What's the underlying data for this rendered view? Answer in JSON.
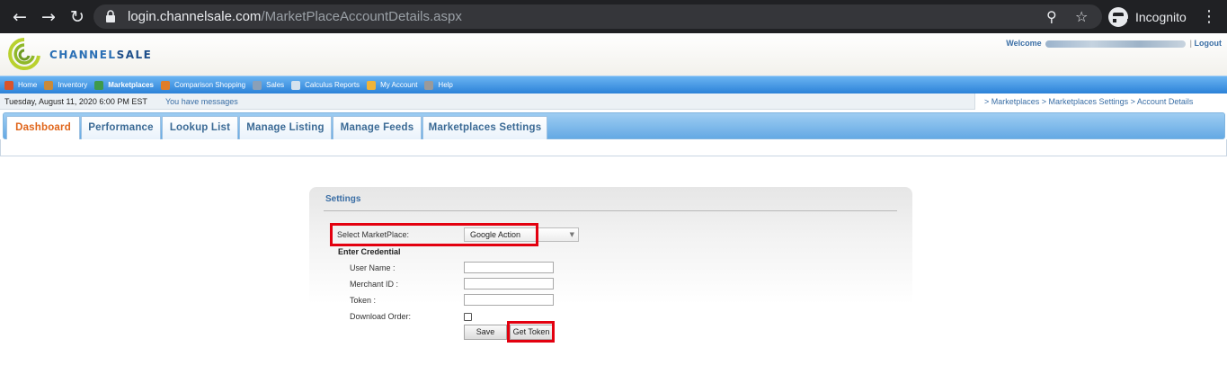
{
  "browser": {
    "url_host": "login.channelsale.com",
    "url_path": "/MarketPlaceAccountDetails.aspx",
    "incognito_label": "Incognito",
    "icons": [
      "back-icon",
      "forward-icon",
      "reload-icon",
      "lock-icon",
      "zoom-icon",
      "star-icon",
      "incognito-icon",
      "kebab-menu-icon"
    ]
  },
  "header": {
    "logo_text_a": "CHANNEL",
    "logo_text_b": "SALE",
    "welcome_label": "Welcome",
    "separator": "|",
    "logout_label": "Logout"
  },
  "mainnav": {
    "items": [
      {
        "label": "Home",
        "icon": "home-icon",
        "color": "#d9542b"
      },
      {
        "label": "Inventory",
        "icon": "inventory-icon",
        "color": "#c98a3a"
      },
      {
        "label": "Marketplaces",
        "icon": "globe-icon",
        "color": "#3f9a4a"
      },
      {
        "label": "Comparison Shopping",
        "icon": "basket-icon",
        "color": "#e07d2a"
      },
      {
        "label": "Sales",
        "icon": "sales-icon",
        "color": "#8aa0b8"
      },
      {
        "label": "Calculus Reports",
        "icon": "chart-icon",
        "color": "#d6e2ee"
      },
      {
        "label": "My Account",
        "icon": "account-icon",
        "color": "#f0b43a"
      },
      {
        "label": "Help",
        "icon": "help-icon",
        "color": "#9a9a9a"
      }
    ]
  },
  "infobar": {
    "date": "Tuesday, August 11, 2020 6:00 PM EST",
    "messages": "You have messages",
    "breadcrumb": "> Marketplaces > Marketplaces Settings > Account Details"
  },
  "tabs": [
    "Dashboard",
    "Performance",
    "Lookup List",
    "Manage Listing",
    "Manage Feeds",
    "Marketplaces Settings"
  ],
  "settings": {
    "title": "Settings",
    "select_marketplace_label": "Select MarketPlace:",
    "selected_marketplace": "Google Action",
    "enter_credential": "Enter Credential",
    "user_name_label": "User Name :",
    "merchant_id_label": "Merchant ID :",
    "token_label": "Token :",
    "download_order_label": "Download Order:",
    "save_label": "Save",
    "get_token_label": "Get Token"
  },
  "colors": {
    "highlight": "#e3000f",
    "link": "#3a6ea5",
    "active_tab": "#e0651a"
  }
}
